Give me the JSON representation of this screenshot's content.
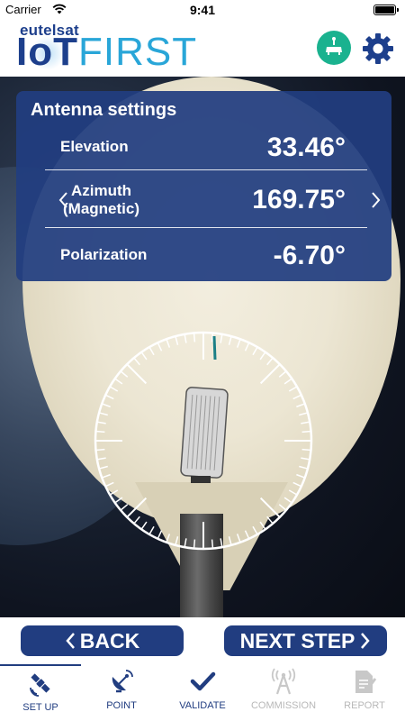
{
  "status_bar": {
    "carrier": "Carrier",
    "time": "9:41"
  },
  "header": {
    "brand_top": "eutelsat",
    "brand_iot": "IoT",
    "brand_first": "FIRST",
    "icons": [
      "terminal-icon",
      "gear-icon"
    ],
    "terminal_button_color": "#1ab28f"
  },
  "antenna_settings": {
    "title": "Antenna settings",
    "elevation": {
      "label": "Elevation",
      "value": "33.46°"
    },
    "azimuth": {
      "label_line1": "Azimuth",
      "label_line2": "(Magnetic)",
      "value": "169.75°"
    },
    "polarization": {
      "label": "Polarization",
      "value": "-6.70°"
    }
  },
  "navigation": {
    "back_label": "BACK",
    "next_label": "NEXT STEP"
  },
  "tabs": [
    {
      "label": "SET UP",
      "icon": "satellite-icon",
      "state": "active"
    },
    {
      "label": "POINT",
      "icon": "satellite-dish-icon",
      "state": "enabled"
    },
    {
      "label": "VALIDATE",
      "icon": "checkmark-icon",
      "state": "enabled"
    },
    {
      "label": "COMMISSION",
      "icon": "antenna-icon",
      "state": "disabled"
    },
    {
      "label": "REPORT",
      "icon": "document-icon",
      "state": "disabled"
    }
  ],
  "colors": {
    "primary": "#213d80",
    "accent_blue": "#29a6d8",
    "accent_green": "#1ab28f",
    "disabled": "#b8b8b8"
  }
}
